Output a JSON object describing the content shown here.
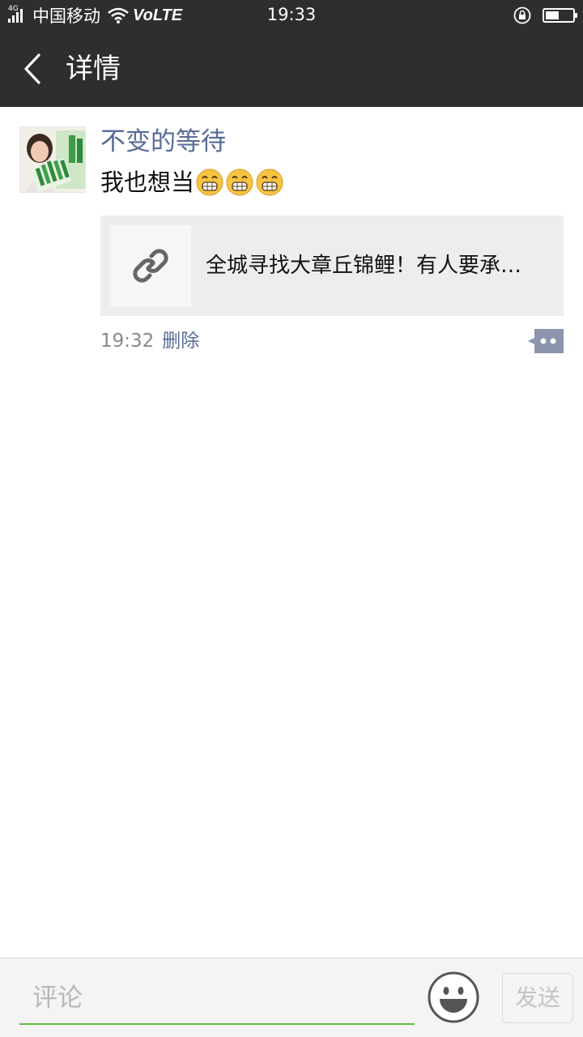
{
  "status_bar": {
    "network_type": "4G",
    "carrier": "中国移动",
    "volte": "VoLTE",
    "time": "19:33",
    "battery_level": 0.45
  },
  "nav": {
    "title": "详情",
    "back_icon": "chevron-left-icon"
  },
  "post": {
    "username": "不变的等待",
    "text": "我也想当",
    "emojis": [
      "grin-emoji",
      "grin-emoji",
      "grin-emoji"
    ],
    "link": {
      "icon": "link-icon",
      "title": "全城寻找大章丘锦鲤！有人要承…"
    },
    "time": "19:32",
    "delete_label": "删除",
    "comment_icon": "comment-bubble-icon"
  },
  "composer": {
    "placeholder": "评论",
    "value": "",
    "emoji_icon": "smiley-icon",
    "send_label": "发送"
  },
  "colors": {
    "bar_bg": "#2e2e2e",
    "link_blue": "#576b95",
    "input_underline": "#5ebd43"
  }
}
